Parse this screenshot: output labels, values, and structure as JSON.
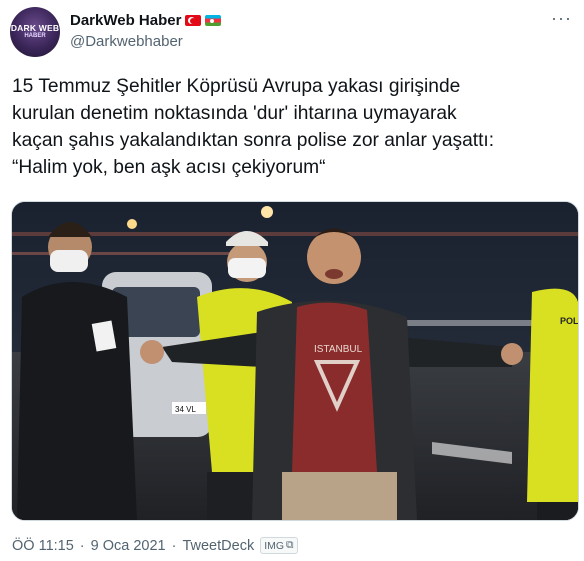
{
  "header": {
    "avatar_text_top": "DARK WEB",
    "avatar_text_bottom": "HABER",
    "display_name": "DarkWeb Haber",
    "handle": "@Darkwebhaber",
    "flags": [
      "turkey-flag",
      "azerbaijan-flag"
    ],
    "more_label": "···"
  },
  "tweet": {
    "text": "15 Temmuz Şehitler Köprüsü Avrupa yakası girişinde\nkurulan denetim noktasında 'dur' ihtarına uymayarak\nkaçan şahıs yakalandıktan sonra polise zor anlar yaşattı:\n“Halim yok, ben aşk acısı çekiyorum“"
  },
  "media": {
    "plate_text": "34 VL",
    "vest_text": "POLİS",
    "shirt_text": "ISTANBUL"
  },
  "footer": {
    "time": "ÖÖ 11:15",
    "separator1": "·",
    "date": "9 Oca 2021",
    "separator2": "·",
    "source": "TweetDeck",
    "badge": "IMG"
  },
  "colors": {
    "text": "#0f1419",
    "muted": "#536471",
    "vest": "#d9e021"
  }
}
